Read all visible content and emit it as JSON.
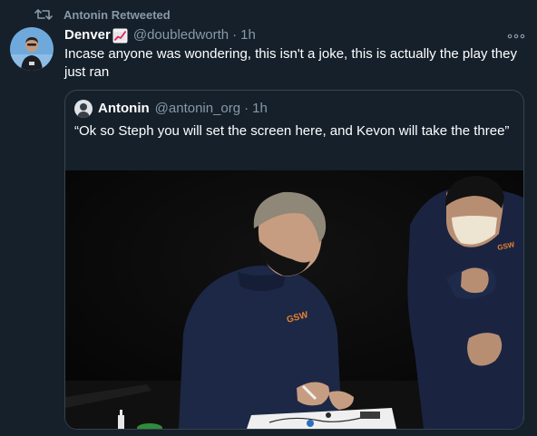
{
  "retweet": {
    "label": "Antonin Retweeted",
    "icon": "retweet-icon"
  },
  "tweet": {
    "author_name": "Denver",
    "author_emoji": "chart-increasing-icon",
    "author_handle": "@doubledworth",
    "separator": "·",
    "time": "1h",
    "text": "Incase anyone was wondering, this isn't a joke, this is actually the play they just ran",
    "more_icon": "more-icon"
  },
  "quote": {
    "author_name": "Antonin",
    "author_handle": "@antonin_org",
    "separator": "·",
    "time": "1h",
    "text": "“Ok so Steph you will set the screen here, and Kevon will take the three”"
  },
  "colors": {
    "background": "#15202b",
    "secondary_text": "#8899a6",
    "border": "#38444d",
    "jersey": "#1c2845",
    "logo": "#e7822f"
  }
}
